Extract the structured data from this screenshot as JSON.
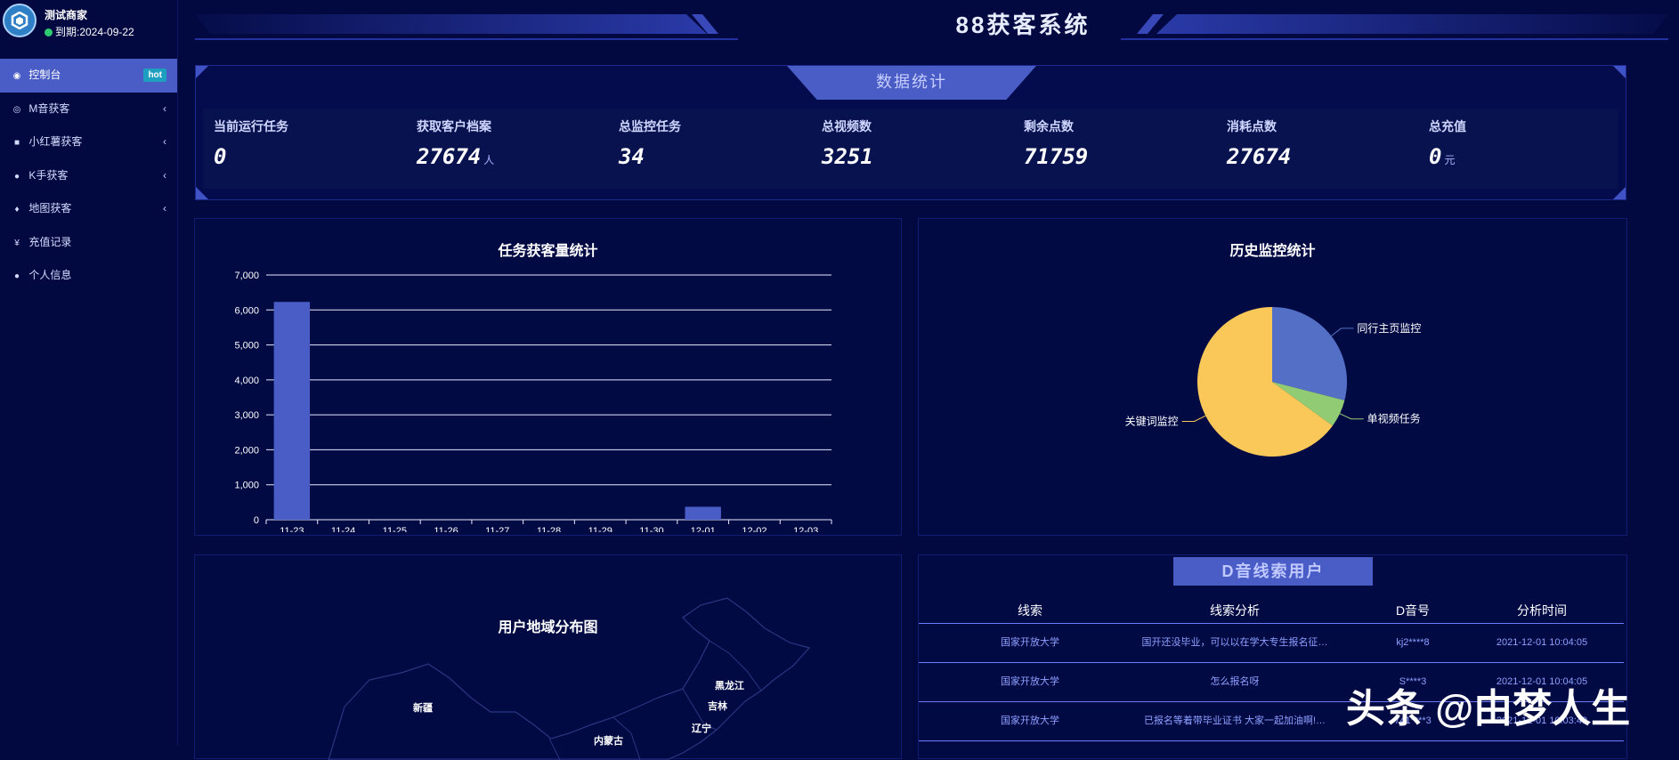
{
  "brand": {
    "name": "测试商家",
    "expire": "到期:2024-09-22"
  },
  "sidebar": {
    "items": [
      {
        "label": "控制台",
        "icon": "dashboard-icon",
        "badge": "hot",
        "active": true
      },
      {
        "label": "M音获客",
        "icon": "eye-icon",
        "has_children": true
      },
      {
        "label": "小红薯获客",
        "icon": "book-icon",
        "has_children": true
      },
      {
        "label": "K手获客",
        "icon": "circle-dot-icon",
        "has_children": true
      },
      {
        "label": "地图获客",
        "icon": "map-pin-icon",
        "has_children": true
      },
      {
        "label": "充值记录",
        "icon": "yen-icon"
      },
      {
        "label": "个人信息",
        "icon": "user-icon"
      }
    ]
  },
  "header": {
    "title": "88获客系统"
  },
  "stats": {
    "title": "数据统计",
    "items": [
      {
        "label": "当前运行任务",
        "value": "0",
        "unit": ""
      },
      {
        "label": "获取客户档案",
        "value": "27674",
        "unit": "人"
      },
      {
        "label": "总监控任务",
        "value": "34",
        "unit": ""
      },
      {
        "label": "总视频数",
        "value": "3251",
        "unit": ""
      },
      {
        "label": "剩余点数",
        "value": "71759",
        "unit": ""
      },
      {
        "label": "消耗点数",
        "value": "27674",
        "unit": ""
      },
      {
        "label": "总充值",
        "value": "0",
        "unit": "元"
      }
    ]
  },
  "bar_panel": {
    "title": "任务获客量统计"
  },
  "pie_panel": {
    "title": "历史监控统计"
  },
  "map_panel": {
    "title": "用户地域分布图",
    "labels": [
      "新疆",
      "黑龙江",
      "吉林",
      "内蒙古",
      "辽宁"
    ]
  },
  "chart_data": [
    {
      "type": "bar",
      "title": "任务获客量统计",
      "categories": [
        "11-23",
        "11-24",
        "11-25",
        "11-26",
        "11-27",
        "11-28",
        "11-29",
        "11-30",
        "12-01",
        "12-02",
        "12-03"
      ],
      "values": [
        6230,
        0,
        0,
        0,
        0,
        0,
        0,
        0,
        370,
        0,
        0
      ],
      "ylim": [
        0,
        7000
      ],
      "yticks": [
        0,
        1000,
        2000,
        3000,
        4000,
        5000,
        6000,
        7000
      ],
      "ytick_labels": [
        "0",
        "1,000",
        "2,000",
        "3,000",
        "4,000",
        "5,000",
        "6,000",
        "7,000"
      ],
      "grid": true,
      "color": "#4a5cc6"
    },
    {
      "type": "pie",
      "title": "历史监控统计",
      "slices": [
        {
          "name": "同行主页监控",
          "value": 29,
          "color": "#5470c6"
        },
        {
          "name": "单视频任务",
          "value": 6,
          "color": "#91cc75"
        },
        {
          "name": "关键词监控",
          "value": 65,
          "color": "#fac858"
        }
      ]
    }
  ],
  "table": {
    "title": "D音线索用户",
    "columns": [
      "线索",
      "线索分析",
      "D音号",
      "分析时间"
    ],
    "rows": [
      [
        "国家开放大学",
        "国开还没毕业，可以以在学大专生报名征…",
        "kj2****8",
        "2021-12-01 10:04:05"
      ],
      [
        "国家开放大学",
        "怎么报名呀",
        "S****3",
        "2021-12-01 10:04:05"
      ],
      [
        "国家开放大学",
        "已报名等着带毕业证书 大家一起加油啊!…",
        "741****3",
        "2021-12-01 10:03:49"
      ]
    ]
  },
  "watermark": {
    "text": "头条 @由梦人生"
  }
}
